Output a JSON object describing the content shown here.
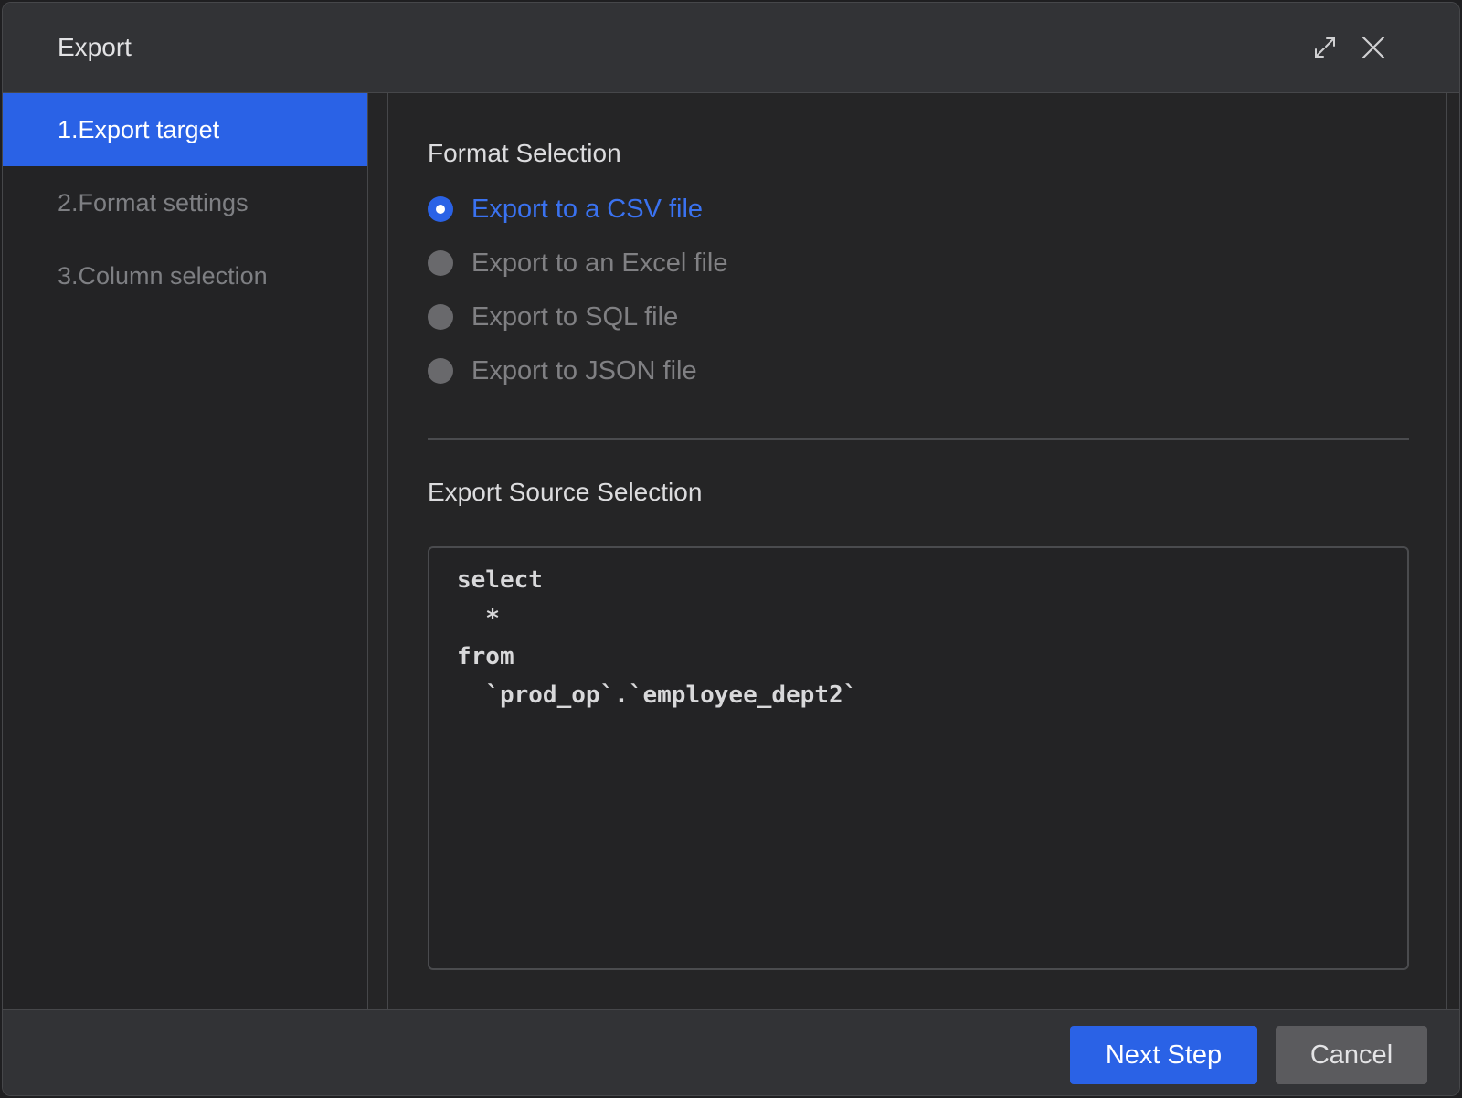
{
  "dialog": {
    "title": "Export",
    "icons": {
      "expand": "expand-icon",
      "close": "close-icon"
    }
  },
  "steps": [
    {
      "label": "1.Export target",
      "active": true
    },
    {
      "label": "2.Format settings",
      "active": false
    },
    {
      "label": "3.Column selection",
      "active": false
    }
  ],
  "format_section": {
    "title": "Format Selection",
    "options": [
      {
        "label": "Export to a CSV file",
        "checked": true
      },
      {
        "label": "Export to an Excel file",
        "checked": false
      },
      {
        "label": "Export to SQL file",
        "checked": false
      },
      {
        "label": "Export to JSON file",
        "checked": false
      }
    ]
  },
  "source_section": {
    "title": "Export Source Selection",
    "code_lines": [
      "select",
      "  *",
      "from",
      "  `prod_op`.`employee_dept2`"
    ]
  },
  "footer": {
    "next_label": "Next Step",
    "cancel_label": "Cancel"
  },
  "colors": {
    "accent": "#2a62e6",
    "background": "#252526",
    "header": "#323336"
  }
}
